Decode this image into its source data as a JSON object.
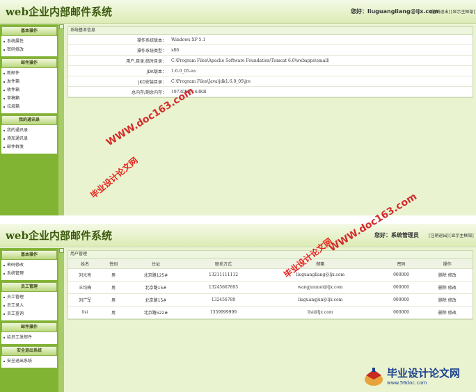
{
  "screen1": {
    "app_title": "web企业内部邮件系统",
    "greeting": "您好：liuguangliang@ljx.com",
    "logout": "[注销退出]",
    "show_frame": "[显示主框架]",
    "sidebar": [
      {
        "title": "基本操作",
        "items": [
          "系统属性",
          "密码修改"
        ]
      },
      {
        "title": "邮件操作",
        "items": [
          "新邮件",
          "发件箱",
          "收件箱",
          "草稿箱",
          "垃圾箱"
        ]
      },
      {
        "title": "我的通讯录",
        "items": [
          "我的通讯录",
          "添加通讯录",
          "邮件群发"
        ]
      }
    ],
    "panel_title": "系统基本信息",
    "info_rows": [
      {
        "key": "操作系统版本：",
        "value": "Windows XP  5.1"
      },
      {
        "key": "操作系统类型：",
        "value": "x86"
      },
      {
        "key": "用户,目录,临时目录：",
        "value": "C:\\Program Files\\Apache Software Foundation\\Tomcat 6.0\\webapps\\email\\"
      },
      {
        "key": "JDK版本：",
        "value": "1.6.0_05-ea"
      },
      {
        "key": "JKD安装目录：",
        "value": "C:\\Program Files\\Java\\jdk1.6.0_05\\jre"
      },
      {
        "key": "总内存/剩余内存：",
        "value": "19730KB  /  63KB"
      }
    ]
  },
  "screen2": {
    "app_title": "web企业内部邮件系统",
    "greeting": "您好：系统管理员",
    "logout": "[注销退出]",
    "show_frame": "[显示主框架]",
    "sidebar": [
      {
        "title": "基本操作",
        "items": [
          "密码修改",
          "系统管理"
        ]
      },
      {
        "title": "员工管理",
        "items": [
          "员工管理",
          "员工录入",
          "员工查询"
        ]
      },
      {
        "title": "邮件操作",
        "items": [
          "给员工发邮件"
        ]
      },
      {
        "title": "安全退出系统",
        "items": [
          "安全退出系统"
        ]
      }
    ],
    "panel_title": "用户管理",
    "columns": [
      "姓名",
      "性别",
      "住址",
      "联系方式",
      "邮箱",
      "密码",
      "操作"
    ],
    "rows": [
      {
        "name": "刘光亮",
        "gender": "男",
        "address": "北京路125#",
        "phone": "13211111112",
        "email": "liuguangliang@ljx.com",
        "password": "000000"
      },
      {
        "name": "王均梅",
        "gender": "男",
        "address": "北京路15#",
        "phone": "13245667895",
        "email": "wangjunmei@ljx.com",
        "password": "000000"
      },
      {
        "name": "刘广军",
        "gender": "男",
        "address": "北京路15#",
        "phone": "132456789",
        "email": "liuguangjun@ljx.com",
        "password": "000000"
      },
      {
        "name": "lisi",
        "gender": "男",
        "address": "北京路522#",
        "phone": "1359999999",
        "email": "lisi@ljx.com",
        "password": "000000"
      }
    ],
    "action_delete": "删除",
    "action_edit": "修改"
  },
  "watermarks": {
    "url": "WWW.doc163.com",
    "text": "毕业设计论文网"
  },
  "logo": {
    "text": "毕业设计论文网",
    "url": "www.56doc.com"
  },
  "colors": {
    "sidebar_green": "#82b434",
    "content_bg": "#e9f3d0",
    "title_green": "#3b5a0e",
    "watermark_red": "#e8231e",
    "logo_blue": "#1a3f8e"
  }
}
